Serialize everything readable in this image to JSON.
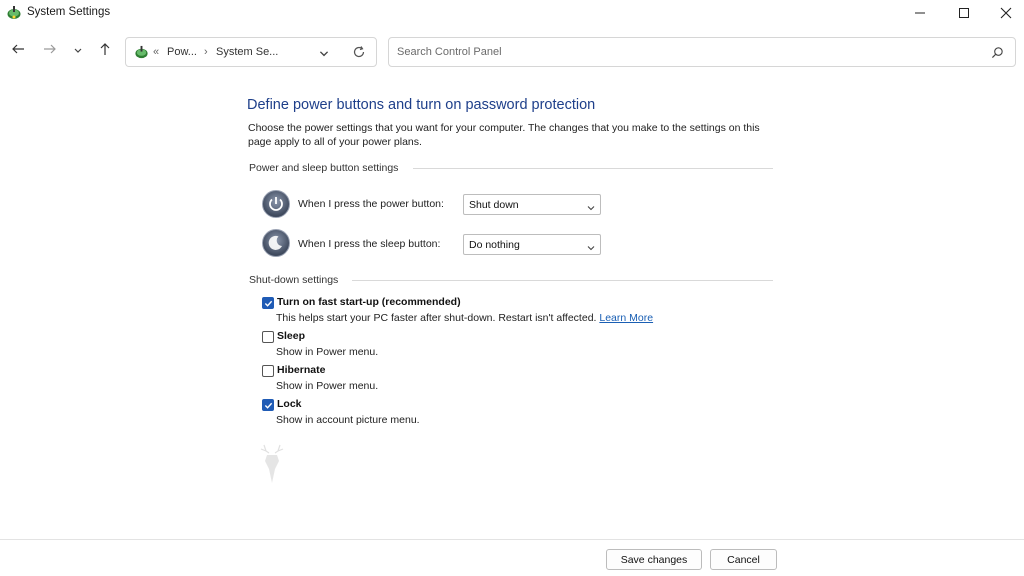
{
  "window": {
    "title": "System Settings",
    "icon": "power-options-icon"
  },
  "nav": {
    "back_icon": "arrow-left-icon",
    "forward_icon": "arrow-right-icon",
    "recent_icon": "chevron-down-icon",
    "up_icon": "arrow-up-icon",
    "address": {
      "overflow": "«",
      "crumb1": "Pow...",
      "separator": "›",
      "crumb2": "System Se..."
    },
    "search_placeholder": "Search Control Panel"
  },
  "page": {
    "heading": "Define power buttons and turn on password protection",
    "description": "Choose the power settings that you want for your computer. The changes that you make to the settings on this page apply to all of your power plans."
  },
  "power_group": {
    "title": "Power and sleep button settings",
    "rows": [
      {
        "label": "When I press the power button:",
        "value": "Shut down",
        "icon": "power-button-icon"
      },
      {
        "label": "When I press the sleep button:",
        "value": "Do nothing",
        "icon": "sleep-button-icon"
      }
    ]
  },
  "shutdown_group": {
    "title": "Shut-down settings",
    "items": [
      {
        "label": "Turn on fast start-up (recommended)",
        "checked": true,
        "description": "This helps start your PC faster after shut-down. Restart isn't affected.",
        "link": "Learn More"
      },
      {
        "label": "Sleep",
        "checked": false,
        "description": "Show in Power menu."
      },
      {
        "label": "Hibernate",
        "checked": false,
        "description": "Show in Power menu."
      },
      {
        "label": "Lock",
        "checked": true,
        "description": "Show in account picture menu."
      }
    ]
  },
  "footer": {
    "save_label": "Save changes",
    "cancel_label": "Cancel"
  },
  "colors": {
    "heading": "#1e3f8a",
    "checkbox_checked": "#1f5bb5",
    "link": "#1a5fb4"
  }
}
